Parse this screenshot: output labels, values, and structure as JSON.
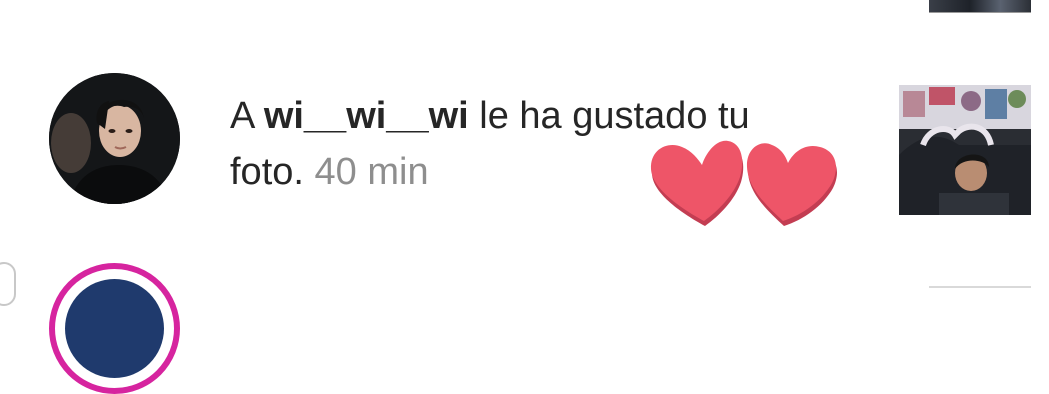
{
  "notification": {
    "prefix": "A ",
    "username": "wi__wi__wi",
    "message": " le ha gustado tu foto.",
    "time": "40 min"
  },
  "icons": {
    "avatar": "profile-photo",
    "thumbnail": "post-photo",
    "stickers": "heart-stickers"
  },
  "colors": {
    "heart": "#ee5568",
    "next_avatar_ring": "#d6249f",
    "time_text": "#8e8e8e"
  }
}
